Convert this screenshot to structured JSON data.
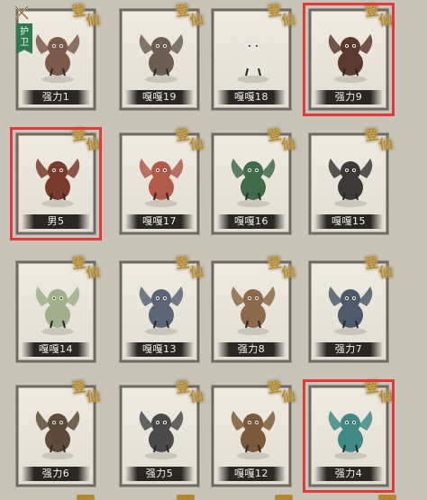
{
  "badge_text": [
    "登",
    "仙"
  ],
  "guard_label": "护卫",
  "cards": [
    {
      "name": "强力1",
      "selected": false,
      "guard": true,
      "color": "#7b5a4a"
    },
    {
      "name": "嘎嘎19",
      "selected": false,
      "guard": false,
      "color": "#6b5f52"
    },
    {
      "name": "嘎嘎18",
      "selected": false,
      "guard": false,
      "color": "#e9e4dc"
    },
    {
      "name": "强力9",
      "selected": true,
      "guard": false,
      "color": "#5a3a2e"
    },
    {
      "name": "男5",
      "selected": true,
      "guard": false,
      "color": "#7a3b2c"
    },
    {
      "name": "嘎嘎17",
      "selected": false,
      "guard": false,
      "color": "#b05a4a"
    },
    {
      "name": "嘎嘎16",
      "selected": false,
      "guard": false,
      "color": "#3f6b4a"
    },
    {
      "name": "嘎嘎15",
      "selected": false,
      "guard": false,
      "color": "#3c3a38"
    },
    {
      "name": "嘎嘎14",
      "selected": false,
      "guard": false,
      "color": "#9fb08a"
    },
    {
      "name": "嘎嘎13",
      "selected": false,
      "guard": false,
      "color": "#5b6577"
    },
    {
      "name": "强力8",
      "selected": false,
      "guard": false,
      "color": "#8a6a4a"
    },
    {
      "name": "强力7",
      "selected": false,
      "guard": false,
      "color": "#4e5a6a"
    },
    {
      "name": "强力6",
      "selected": false,
      "guard": false,
      "color": "#5e4a3a"
    },
    {
      "name": "强力5",
      "selected": false,
      "guard": false,
      "color": "#4a4a4a"
    },
    {
      "name": "嘎嘎12",
      "selected": false,
      "guard": false,
      "color": "#7a5a3a"
    },
    {
      "name": "强力4",
      "selected": true,
      "guard": false,
      "color": "#3f8a86"
    }
  ],
  "colors": {
    "selection": "#e23a3a",
    "badge": "#b58a2e",
    "background": "#c9c4b8"
  }
}
